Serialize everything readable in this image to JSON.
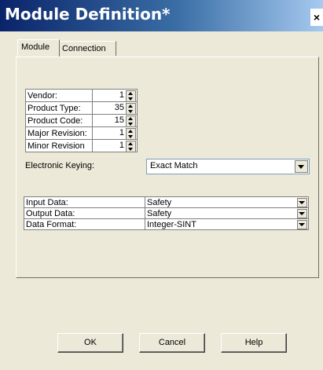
{
  "window": {
    "title": "Module Definition*",
    "close_glyph": "×"
  },
  "tabs": [
    {
      "label": "Module"
    },
    {
      "label": "Connection"
    }
  ],
  "module_fields": [
    {
      "label": "Vendor:",
      "value": "1"
    },
    {
      "label": "Product Type:",
      "value": "35"
    },
    {
      "label": "Product Code:",
      "value": "15"
    },
    {
      "label": "Major Revision:",
      "value": "1"
    },
    {
      "label": "Minor Revision",
      "value": "1"
    }
  ],
  "keying": {
    "label": "Electronic Keying:",
    "value": "Exact Match"
  },
  "data_rows": [
    {
      "label": "Input Data:",
      "value": "Safety"
    },
    {
      "label": "Output Data:",
      "value": "Safety"
    },
    {
      "label": "Data Format:",
      "value": "Integer-SINT"
    }
  ],
  "buttons": {
    "ok": "OK",
    "cancel": "Cancel",
    "help": "Help"
  }
}
